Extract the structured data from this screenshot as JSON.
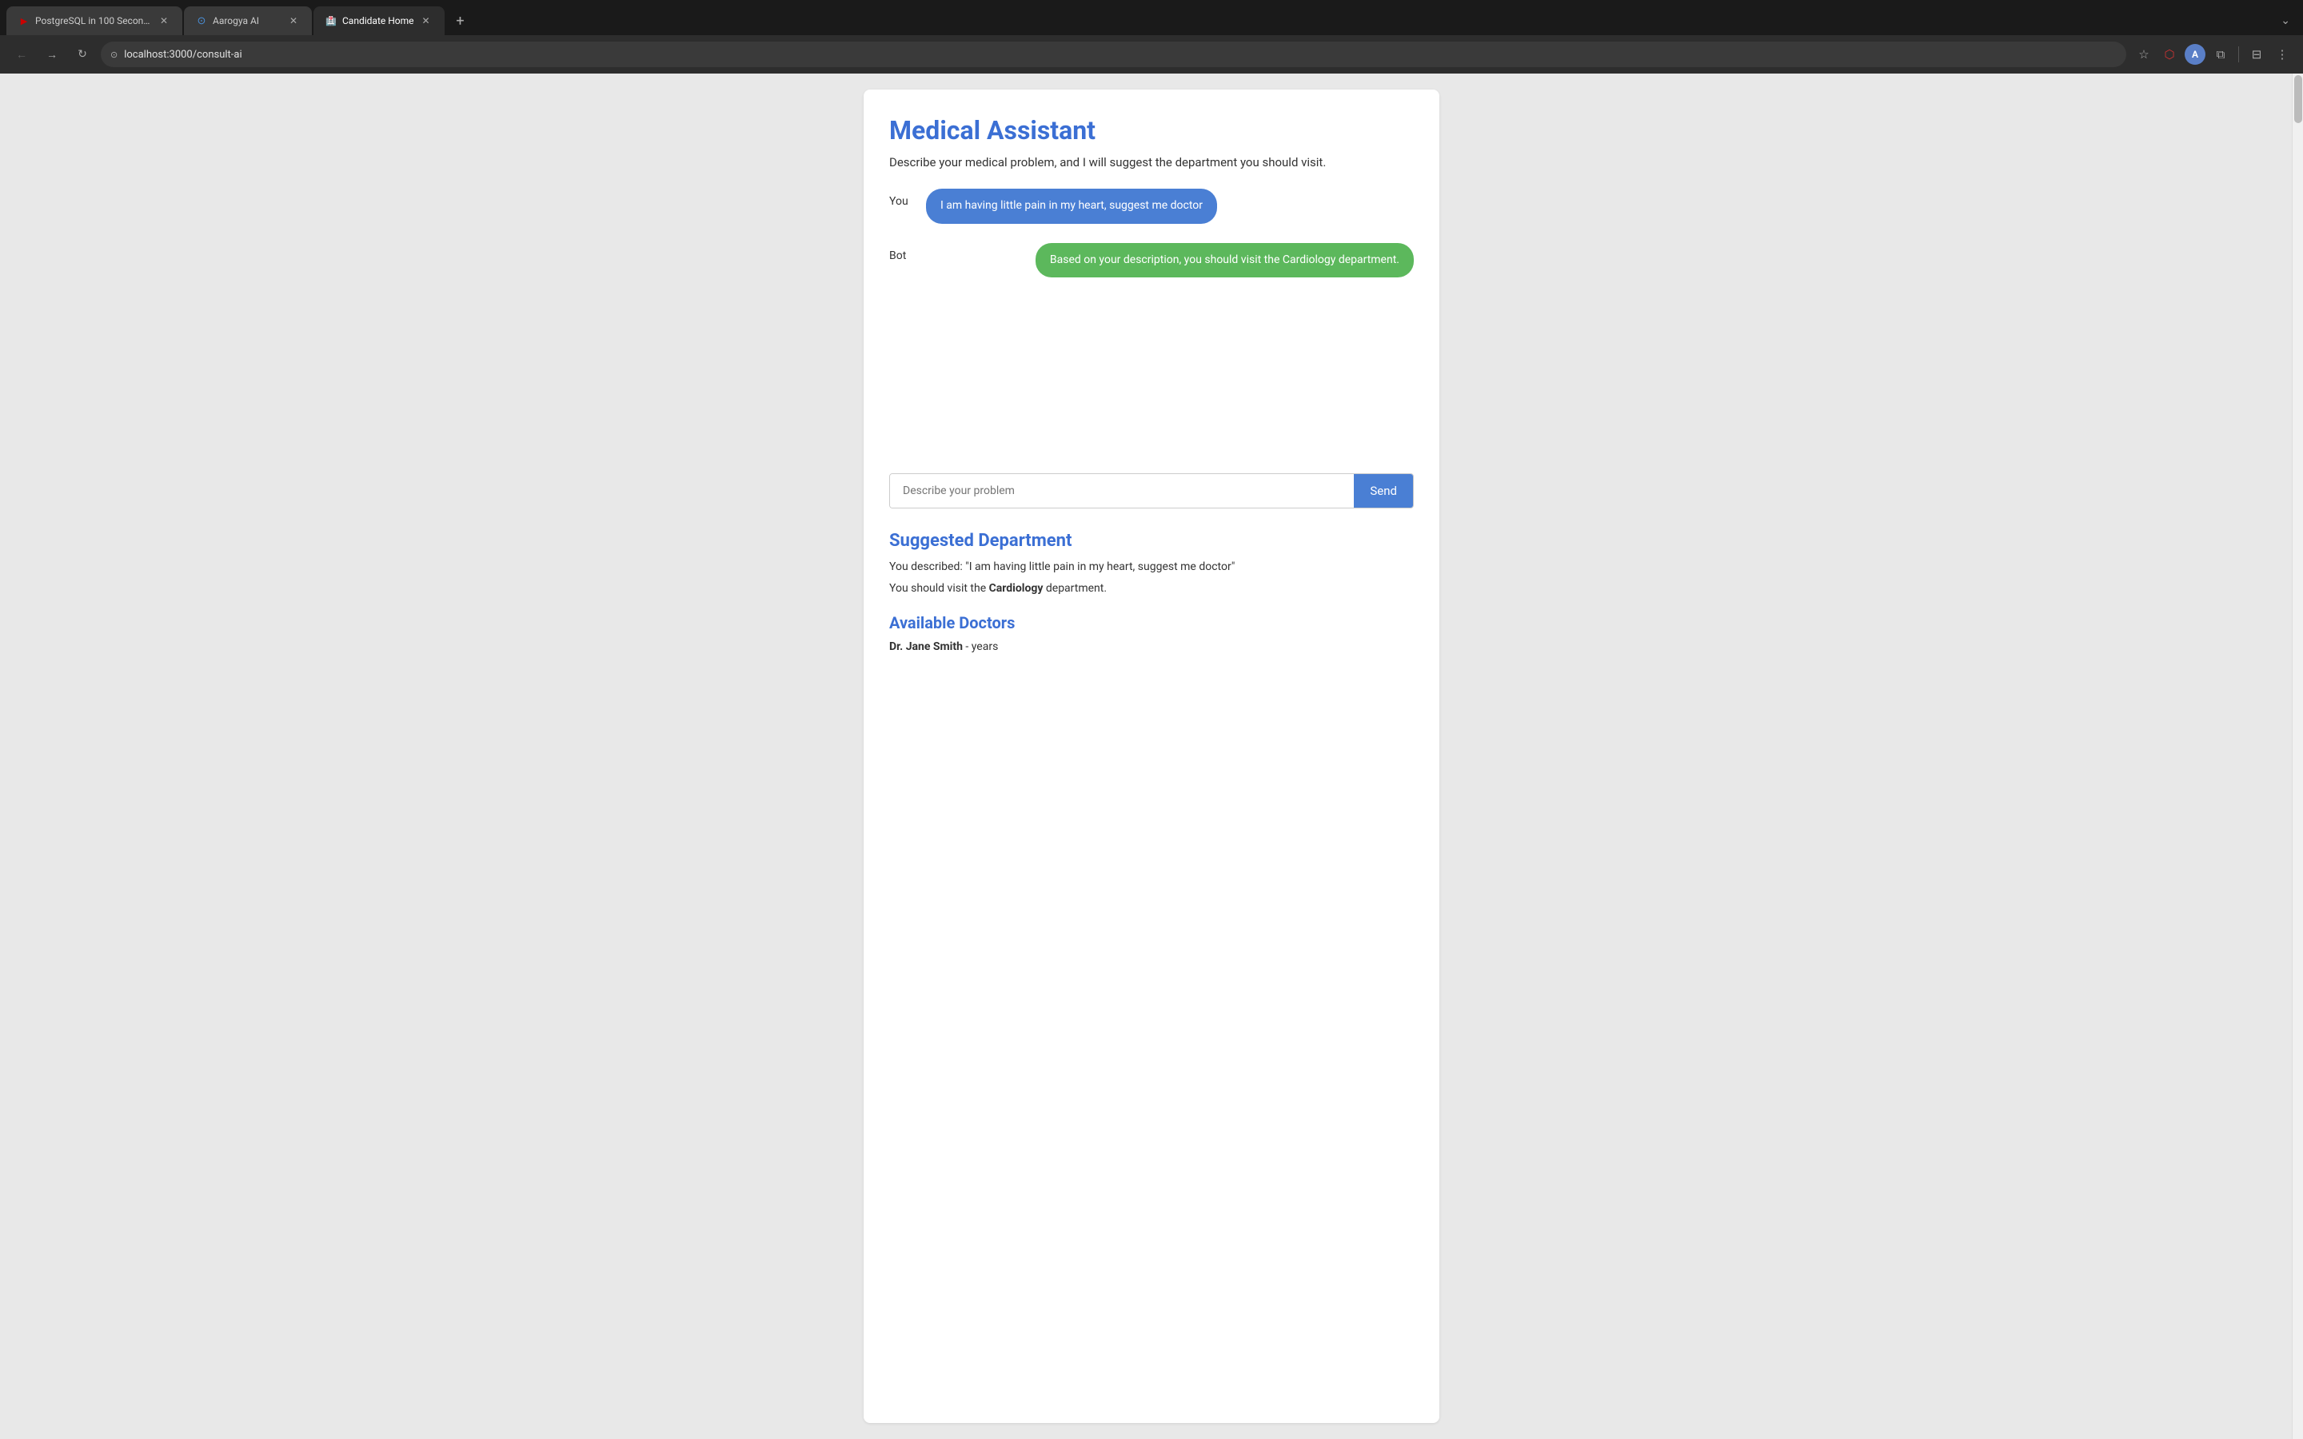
{
  "browser": {
    "tabs": [
      {
        "id": "tab1",
        "favicon": "▶",
        "favicon_color": "#cc0000",
        "title": "PostgreSQL in 100 Seconds",
        "active": false
      },
      {
        "id": "tab2",
        "favicon": "◎",
        "favicon_color": "#4a90d9",
        "title": "Aarogya AI",
        "active": false
      },
      {
        "id": "tab3",
        "favicon": "🏥",
        "favicon_color": "#4a90d9",
        "title": "Candidate Home",
        "active": true
      }
    ],
    "address": "localhost:3000/consult-ai"
  },
  "page": {
    "title": "Medical Assistant",
    "subtitle": "Describe your medical problem, and I will suggest the department you should visit.",
    "chat": {
      "user_label": "You",
      "bot_label": "Bot",
      "user_message": "I am having little pain in my heart, suggest me doctor",
      "bot_message": "Based on your description, you should visit the Cardiology department."
    },
    "input": {
      "placeholder": "Describe your problem",
      "send_label": "Send"
    },
    "suggested": {
      "section_title": "Suggested Department",
      "description_line1": "You described: \"I am having little pain in my heart, suggest me doctor\"",
      "description_line2_prefix": "You should visit the ",
      "description_department": "Cardiology",
      "description_line2_suffix": " department.",
      "doctors_title": "Available Doctors",
      "doctor_name": "Dr. Jane Smith",
      "doctor_suffix": " - years"
    }
  }
}
